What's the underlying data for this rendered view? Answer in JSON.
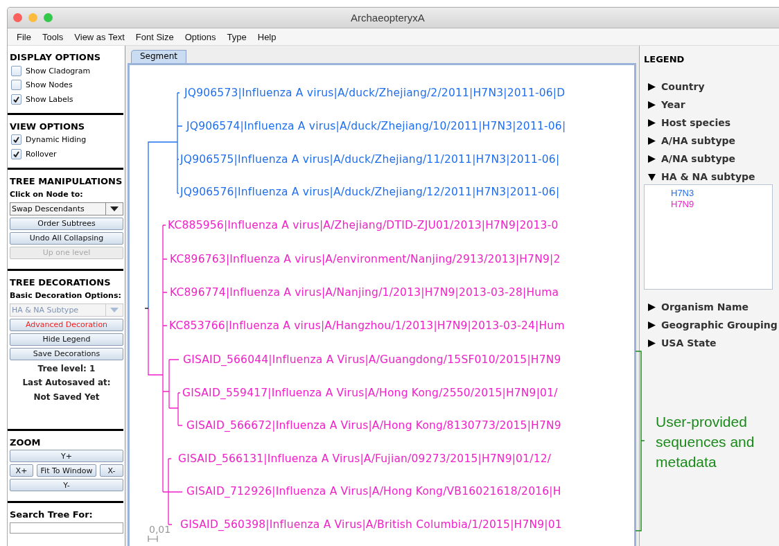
{
  "window": {
    "title": "ArchaeopteryxA"
  },
  "menu": [
    "File",
    "Tools",
    "View as Text",
    "Font Size",
    "Options",
    "Type",
    "Help"
  ],
  "display_options": {
    "title": "DISPLAY OPTIONS",
    "items": [
      {
        "label": "Show Cladogram",
        "checked": false
      },
      {
        "label": "Show Nodes",
        "checked": false
      },
      {
        "label": "Show Labels",
        "checked": true
      }
    ]
  },
  "view_options": {
    "title": "VIEW OPTIONS",
    "items": [
      {
        "label": "Dynamic Hiding",
        "checked": true
      },
      {
        "label": "Rollover",
        "checked": true
      }
    ]
  },
  "tree_manipulations": {
    "title": "TREE MANIPULATIONS",
    "prompt": "Click on Node to:",
    "dropdown": {
      "value": "Swap Descendants",
      "disabled": false
    },
    "buttons": [
      {
        "label": "Order Subtrees",
        "disabled": false,
        "highlighted": false
      },
      {
        "label": "Undo All Collapsing",
        "disabled": false,
        "highlighted": false
      },
      {
        "label": "Up one level",
        "disabled": true,
        "highlighted": false
      }
    ]
  },
  "tree_decorations": {
    "title": "TREE DECORATIONS",
    "prompt": "Basic Decoration Options:",
    "dropdown": {
      "value": "HA & NA Subtype",
      "disabled": true
    },
    "buttons": [
      {
        "label": "Advanced Decoration",
        "disabled": false,
        "highlighted": true
      },
      {
        "label": "Hide Legend",
        "disabled": false,
        "highlighted": false
      },
      {
        "label": "Save Decorations",
        "disabled": false,
        "highlighted": false
      }
    ],
    "status": [
      "Tree level: 1",
      "Last Autosaved at:",
      "Not Saved Yet"
    ]
  },
  "zoom": {
    "title": "ZOOM",
    "y_plus": "Y+",
    "x_plus": "X+",
    "fit": "Fit To Window",
    "x_minus": "X-",
    "y_minus": "Y-"
  },
  "search": {
    "label": "Search Tree For:"
  },
  "tabs": [
    {
      "label": "Segment",
      "selected": true
    }
  ],
  "tree": {
    "scale": "0,01",
    "leaves": [
      {
        "label": "JQ906573|Influenza A virus|A/duck/Zhejiang/2/2011|H7N3|2011-06|D",
        "color": "#1f6ff0"
      },
      {
        "label": "JQ906574|Influenza A virus|A/duck/Zhejiang/10/2011|H7N3|2011-06|",
        "color": "#1f6ff0"
      },
      {
        "label": "JQ906575|Influenza A virus|A/duck/Zhejiang/11/2011|H7N3|2011-06|",
        "color": "#1f6ff0"
      },
      {
        "label": "JQ906576|Influenza A virus|A/duck/Zhejiang/12/2011|H7N3|2011-06|",
        "color": "#1f6ff0"
      },
      {
        "label": "KC885956|Influenza A virus|A/Zhejiang/DTID-ZJU01/2013|H7N9|2013-0",
        "color": "#f020c8"
      },
      {
        "label": "KC896763|Influenza A virus|A/environment/Nanjing/2913/2013|H7N9|2",
        "color": "#f020c8"
      },
      {
        "label": "KC896774|Influenza A virus|A/Nanjing/1/2013|H7N9|2013-03-28|Huma",
        "color": "#f020c8"
      },
      {
        "label": "KC853766|Influenza A virus|A/Hangzhou/1/2013|H7N9|2013-03-24|Hum",
        "color": "#f020c8"
      },
      {
        "label": "GISAID_566044|Influenza A Virus|A/Guangdong/15SF010/2015|H7N9",
        "color": "#f020c8"
      },
      {
        "label": "GISAID_559417|Influenza A Virus|A/Hong Kong/2550/2015|H7N9|01/",
        "color": "#f020c8"
      },
      {
        "label": "GISAID_566672|Influenza A Virus|A/Hong Kong/8130773/2015|H7N9",
        "color": "#f020c8"
      },
      {
        "label": "GISAID_566131|Influenza A Virus|A/Fujian/09273/2015|H7N9|01/12/",
        "color": "#f020c8"
      },
      {
        "label": "GISAID_712926|Influenza A Virus|A/Hong Kong/VB16021618/2016|H",
        "color": "#f020c8"
      },
      {
        "label": "GISAID_560398|Influenza A Virus|A/British Columbia/1/2015|H7N9|01",
        "color": "#f020c8"
      }
    ]
  },
  "legend": {
    "title": "LEGEND",
    "items": [
      {
        "label": "Country",
        "expanded": false
      },
      {
        "label": "Year",
        "expanded": false
      },
      {
        "label": "Host species",
        "expanded": false
      },
      {
        "label": "A/HA subtype",
        "expanded": false
      },
      {
        "label": "A/NA subtype",
        "expanded": false
      },
      {
        "label": "HA & NA subtype",
        "expanded": true,
        "values": [
          {
            "label": "H7N3",
            "color": "#1f6ff0"
          },
          {
            "label": "H7N9",
            "color": "#f020c8"
          }
        ]
      },
      {
        "label": "Organism Name",
        "expanded": false
      },
      {
        "label": "Geographic Grouping",
        "expanded": false
      },
      {
        "label": "USA State",
        "expanded": false
      }
    ]
  },
  "annotation": {
    "text": "User-provided sequences and metadata"
  }
}
